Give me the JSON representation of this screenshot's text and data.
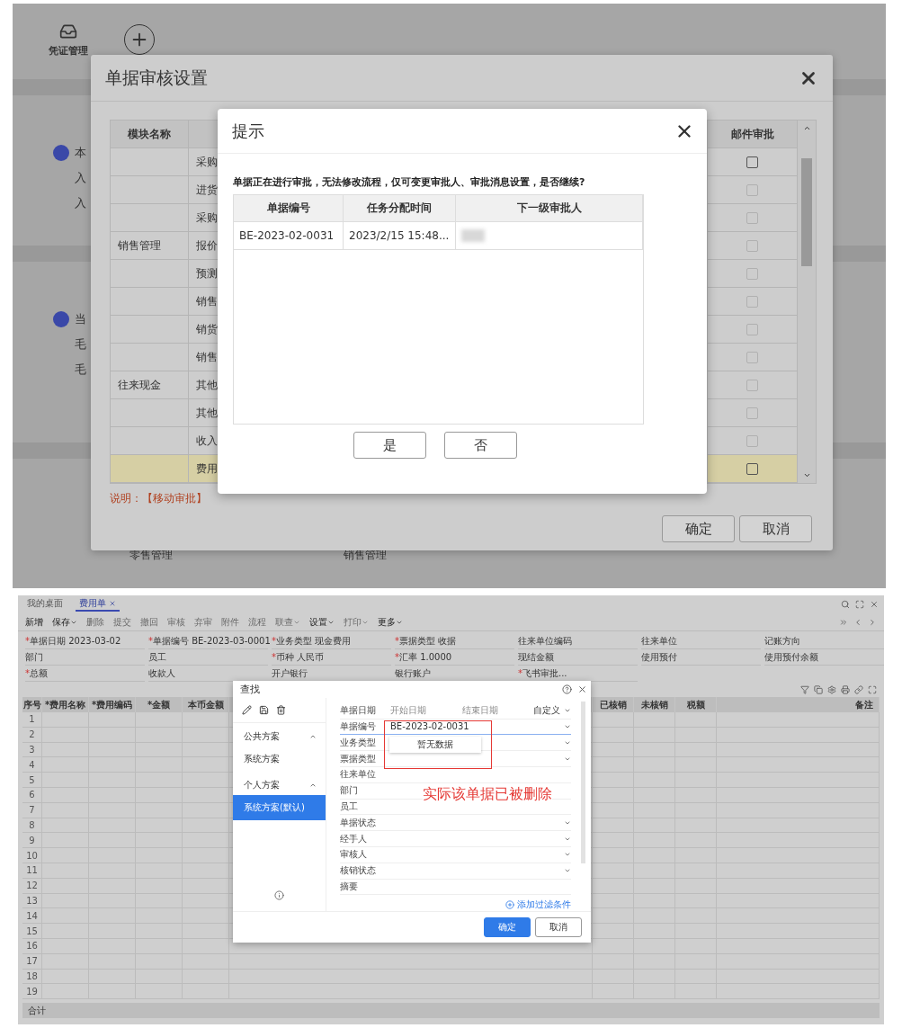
{
  "top_screenshot": {
    "background": {
      "app_label": "凭证管理",
      "side_groups": [
        {
          "lines": [
            "本",
            "入",
            "入"
          ]
        },
        {
          "lines": [
            "当",
            "毛",
            "毛"
          ]
        }
      ],
      "flow_labels": [
        "零售管理",
        "销售管理"
      ]
    },
    "settings_dialog": {
      "title": "单据审核设置",
      "columns": [
        "模块名称",
        "邮件审批"
      ],
      "rows": [
        {
          "item": "采购",
          "disabled": false,
          "checked": false,
          "selected": false
        },
        {
          "item": "进货",
          "disabled": true,
          "checked": false,
          "selected": false
        },
        {
          "item": "采购",
          "disabled": true,
          "checked": false,
          "selected": false
        },
        {
          "module": "销售管理",
          "item": "报价",
          "disabled": true,
          "checked": false,
          "selected": false
        },
        {
          "item": "预测",
          "disabled": true,
          "checked": false,
          "selected": false
        },
        {
          "item": "销售",
          "disabled": true,
          "checked": false,
          "selected": false
        },
        {
          "item": "销货",
          "disabled": true,
          "checked": false,
          "selected": false
        },
        {
          "item": "销售",
          "disabled": true,
          "checked": false,
          "selected": false
        },
        {
          "module": "往来现金",
          "item": "其他",
          "disabled": true,
          "checked": false,
          "selected": false
        },
        {
          "item": "其他",
          "disabled": true,
          "checked": false,
          "selected": false
        },
        {
          "item": "收入",
          "disabled": true,
          "checked": false,
          "selected": false
        },
        {
          "item": "费用",
          "disabled": false,
          "checked": false,
          "selected": true
        }
      ],
      "note": "说明：【移动审批】",
      "buttons": [
        "确定",
        "取消"
      ]
    },
    "prompt": {
      "title": "提示",
      "message": "单据正在进行审批，无法修改流程，仅可变更审批人、审批消息设置，是否继续?",
      "columns": [
        "单据编号",
        "任务分配时间",
        "下一级审批人"
      ],
      "rows": [
        {
          "number": "BE-2023-02-0031",
          "time": "2023/2/15 15:48..."
        }
      ],
      "buttons": [
        "是",
        "否"
      ]
    }
  },
  "bottom_screenshot": {
    "tabs": [
      {
        "label": "我的桌面",
        "selected": false,
        "closable": false
      },
      {
        "label": "费用单",
        "selected": true,
        "closable": true
      }
    ],
    "toolbar": [
      {
        "label": "新增",
        "menu": false,
        "disabled": false
      },
      {
        "label": "保存",
        "menu": true,
        "disabled": false
      },
      {
        "label": "删除",
        "menu": false,
        "disabled": true
      },
      {
        "label": "提交",
        "menu": false,
        "disabled": true
      },
      {
        "label": "撤回",
        "menu": false,
        "disabled": true
      },
      {
        "label": "审核",
        "menu": false,
        "disabled": true
      },
      {
        "label": "弃审",
        "menu": false,
        "disabled": true
      },
      {
        "label": "附件",
        "menu": false,
        "disabled": true
      },
      {
        "label": "流程",
        "menu": false,
        "disabled": true
      },
      {
        "label": "联查",
        "menu": true,
        "disabled": true
      },
      {
        "label": "设置",
        "menu": true,
        "disabled": false
      },
      {
        "label": "打印",
        "menu": true,
        "disabled": true
      },
      {
        "label": "更多",
        "menu": true,
        "disabled": false
      }
    ],
    "form_rows": [
      [
        {
          "mark": "*",
          "label": "单据日期",
          "value": "2023-03-02"
        },
        {
          "mark": "*",
          "label": "单据编号",
          "value": "BE-2023-03-0001"
        },
        {
          "mark": "*",
          "label": "业务类型",
          "value": "现金费用"
        },
        {
          "mark": "*",
          "label": "票据类型",
          "value": "收据"
        },
        {
          "label": "往来单位编码"
        },
        {
          "label": "往来单位"
        },
        {
          "label": "记账方向"
        }
      ],
      [
        {
          "label": "部门"
        },
        {
          "label": "员工"
        },
        {
          "mark": "*",
          "label": "币种",
          "value": "人民币"
        },
        {
          "mark": "*",
          "label": "汇率",
          "value": "1.0000"
        },
        {
          "label": "现结金额"
        },
        {
          "label": "使用预付"
        },
        {
          "label": "使用预付余额"
        }
      ],
      [
        {
          "mark": "*",
          "label": "总额"
        },
        {
          "label": "收款人"
        },
        {
          "label": "开户银行"
        },
        {
          "label": "银行账户"
        },
        {
          "mark": "*",
          "label": "飞书审批..."
        }
      ]
    ],
    "grid": {
      "columns": [
        "序号",
        "*费用名称",
        "*费用编码",
        "*金额",
        "本币金额",
        "已核销",
        "未核销",
        "税额",
        "备注"
      ],
      "row_numbers": [
        "1",
        "2",
        "3",
        "4",
        "5",
        "6",
        "7",
        "8",
        "9",
        "10",
        "11",
        "12",
        "13",
        "14",
        "15",
        "16",
        "17",
        "18",
        "19"
      ],
      "footer": "合计"
    },
    "find_dialog": {
      "title": "查找",
      "schemes": [
        {
          "label": "公共方案",
          "expanded": true,
          "children": [
            {
              "label": "系统方案",
              "selected": false
            }
          ]
        },
        {
          "label": "个人方案",
          "expanded": true,
          "children": [
            {
              "label": "系统方案(默认)",
              "selected": true
            }
          ]
        }
      ],
      "fields": [
        {
          "kind": "range",
          "label": "单据日期",
          "from": "开始日期",
          "to": "结束日期",
          "option": "自定义"
        },
        {
          "kind": "select",
          "label": "单据编号",
          "value": "BE-2023-02-0031",
          "focused": true
        },
        {
          "kind": "select",
          "label": "业务类型",
          "focused": false
        },
        {
          "kind": "select",
          "label": "票据类型",
          "focused": false
        },
        {
          "kind": "text",
          "label": "往来单位"
        },
        {
          "kind": "text",
          "label": "部门"
        },
        {
          "kind": "text",
          "label": "员工"
        },
        {
          "kind": "select",
          "label": "单据状态",
          "focused": false
        },
        {
          "kind": "select",
          "label": "经手人",
          "focused": false
        },
        {
          "kind": "select",
          "label": "审核人",
          "focused": false
        },
        {
          "kind": "select",
          "label": "核销状态",
          "focused": false
        },
        {
          "kind": "text",
          "label": "摘要"
        }
      ],
      "dropdown": "暂无数据",
      "annotation": "实际该单据已被删除",
      "add_filter": "添加过滤条件",
      "buttons": [
        {
          "label": "确定",
          "primary": true
        },
        {
          "label": "取消",
          "primary": false
        }
      ]
    }
  }
}
